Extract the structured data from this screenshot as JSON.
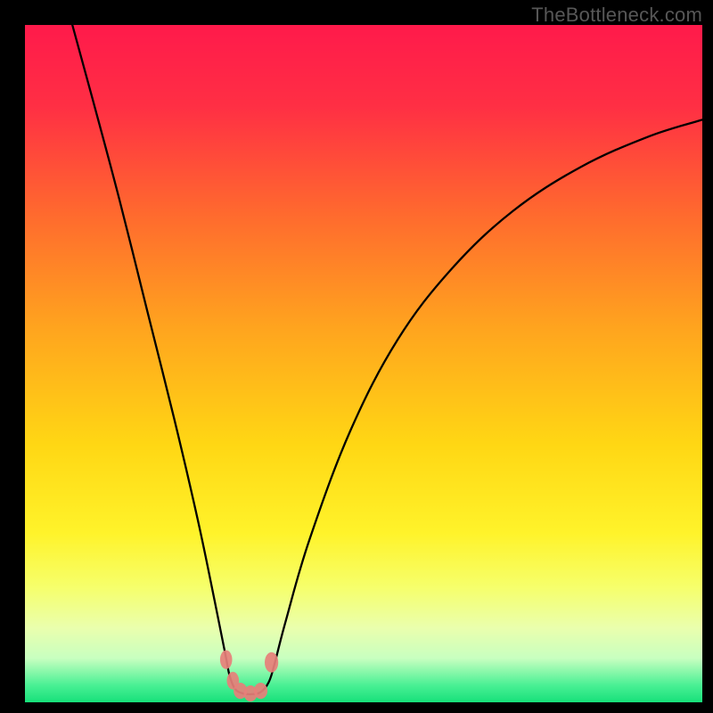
{
  "watermark": "TheBottleneck.com",
  "chart_data": {
    "type": "line",
    "title": "",
    "xlabel": "",
    "ylabel": "",
    "xlim": [
      0,
      100
    ],
    "ylim": [
      0,
      100
    ],
    "grid": false,
    "legend": false,
    "background_gradient_stops": [
      {
        "offset": 0.0,
        "color": "#ff1a4b"
      },
      {
        "offset": 0.12,
        "color": "#ff2f44"
      },
      {
        "offset": 0.28,
        "color": "#ff6a2e"
      },
      {
        "offset": 0.45,
        "color": "#ffa51e"
      },
      {
        "offset": 0.62,
        "color": "#ffd714"
      },
      {
        "offset": 0.75,
        "color": "#fff32a"
      },
      {
        "offset": 0.83,
        "color": "#f6ff6b"
      },
      {
        "offset": 0.89,
        "color": "#eaffad"
      },
      {
        "offset": 0.935,
        "color": "#c8ffc0"
      },
      {
        "offset": 0.975,
        "color": "#49f094"
      },
      {
        "offset": 1.0,
        "color": "#17e07a"
      }
    ],
    "series": [
      {
        "name": "bottleneck-curve",
        "is_path": true,
        "stroke": "#000000",
        "stroke_width": 2.3,
        "points": [
          {
            "x": 7.0,
            "y": 100.0
          },
          {
            "x": 10.0,
            "y": 89.0
          },
          {
            "x": 14.0,
            "y": 74.0
          },
          {
            "x": 18.0,
            "y": 58.0
          },
          {
            "x": 22.0,
            "y": 42.0
          },
          {
            "x": 25.5,
            "y": 27.0
          },
          {
            "x": 28.0,
            "y": 15.0
          },
          {
            "x": 29.6,
            "y": 7.0
          },
          {
            "x": 30.2,
            "y": 4.0
          },
          {
            "x": 31.0,
            "y": 2.0
          },
          {
            "x": 32.2,
            "y": 1.3
          },
          {
            "x": 33.5,
            "y": 1.2
          },
          {
            "x": 34.8,
            "y": 1.5
          },
          {
            "x": 36.0,
            "y": 3.0
          },
          {
            "x": 36.8,
            "y": 5.5
          },
          {
            "x": 38.5,
            "y": 12.0
          },
          {
            "x": 42.0,
            "y": 24.0
          },
          {
            "x": 48.0,
            "y": 40.0
          },
          {
            "x": 55.0,
            "y": 53.5
          },
          {
            "x": 63.0,
            "y": 64.0
          },
          {
            "x": 72.0,
            "y": 72.5
          },
          {
            "x": 82.0,
            "y": 79.0
          },
          {
            "x": 92.0,
            "y": 83.5
          },
          {
            "x": 100.0,
            "y": 86.0
          }
        ]
      }
    ],
    "markers": [
      {
        "x": 29.7,
        "y": 6.3,
        "rx": 0.9,
        "ry": 1.4,
        "color": "#e77f79"
      },
      {
        "x": 30.7,
        "y": 3.2,
        "rx": 0.9,
        "ry": 1.3,
        "color": "#e77f79"
      },
      {
        "x": 31.8,
        "y": 1.7,
        "rx": 1.0,
        "ry": 1.2,
        "color": "#e77f79"
      },
      {
        "x": 33.3,
        "y": 1.3,
        "rx": 1.0,
        "ry": 1.2,
        "color": "#e77f79"
      },
      {
        "x": 34.8,
        "y": 1.7,
        "rx": 1.0,
        "ry": 1.2,
        "color": "#e77f79"
      },
      {
        "x": 36.4,
        "y": 5.9,
        "rx": 1.0,
        "ry": 1.5,
        "color": "#e77f79"
      }
    ]
  }
}
